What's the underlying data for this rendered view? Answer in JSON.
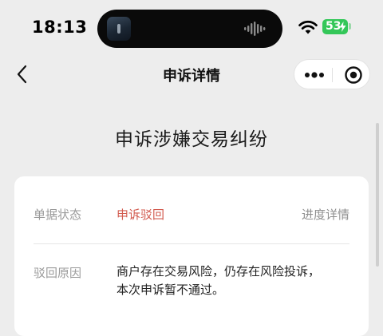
{
  "status_bar": {
    "time": "18:13",
    "battery": "53"
  },
  "nav": {
    "title": "申诉详情"
  },
  "heading": "申诉涉嫌交易纠纷",
  "details": {
    "status_label": "单据状态",
    "status_value": "申诉驳回",
    "progress_link": "进度详情",
    "reason_label": "驳回原因",
    "reason_line1": "商户存在交易风险，仍存在风险投诉，",
    "reason_line2": "本次申诉暂不通过。"
  },
  "colors": {
    "status_rejected": "#d25b4f",
    "battery": "#34c759",
    "background": "#ededed"
  },
  "icons": [
    "back-arrow-icon",
    "more-dots-icon",
    "close-target-icon",
    "wifi-icon",
    "battery-icon",
    "audio-wave-icon"
  ]
}
